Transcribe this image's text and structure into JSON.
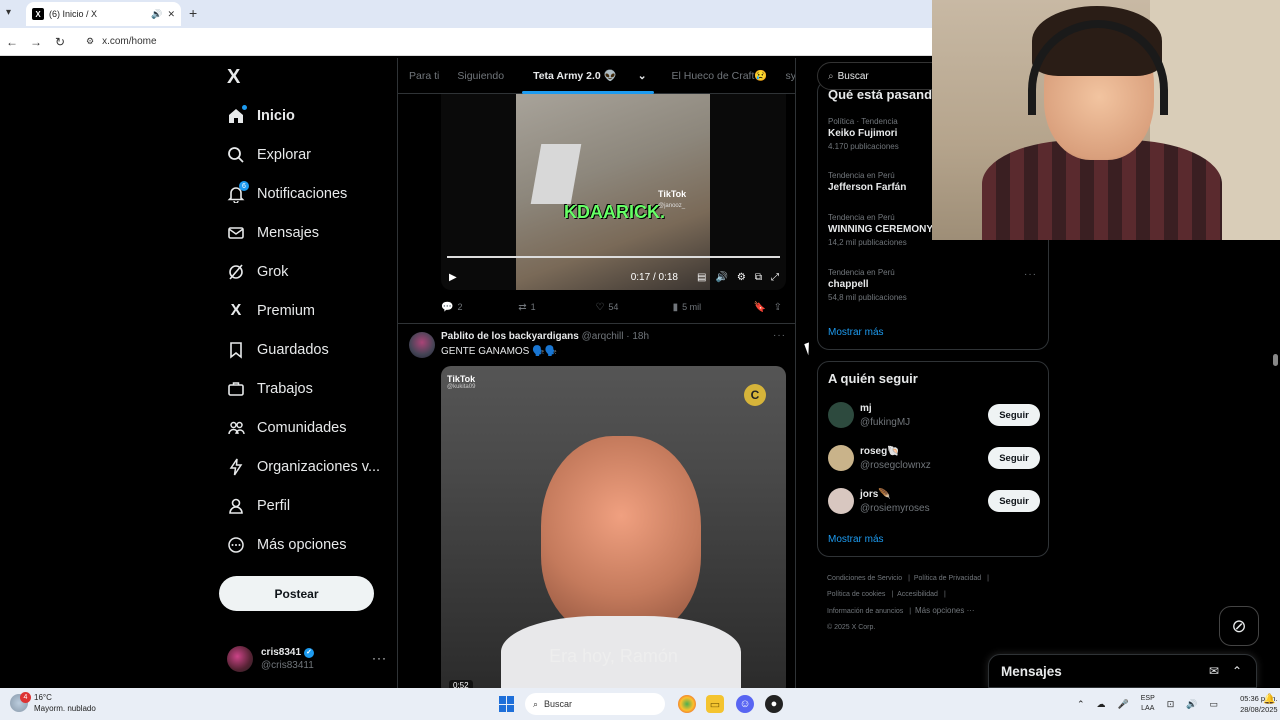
{
  "browser": {
    "tab_title": "(6) Inicio / X",
    "url": "x.com/home",
    "tab_audio_icon": "speaker-icon",
    "new_tab": "+"
  },
  "leftnav": {
    "logo": "X",
    "items": [
      {
        "label": "Inicio",
        "icon": "home-icon",
        "active": true
      },
      {
        "label": "Explorar",
        "icon": "search-icon"
      },
      {
        "label": "Notificaciones",
        "icon": "bell-icon",
        "badge": "6"
      },
      {
        "label": "Mensajes",
        "icon": "envelope-icon"
      },
      {
        "label": "Grok",
        "icon": "grok-icon"
      },
      {
        "label": "Premium",
        "icon": "x-icon"
      },
      {
        "label": "Guardados",
        "icon": "bookmark-icon"
      },
      {
        "label": "Trabajos",
        "icon": "briefcase-icon"
      },
      {
        "label": "Comunidades",
        "icon": "people-icon"
      },
      {
        "label": "Organizaciones v...",
        "icon": "lightning-icon"
      },
      {
        "label": "Perfil",
        "icon": "person-icon"
      },
      {
        "label": "Más opciones",
        "icon": "more-circle-icon"
      }
    ],
    "post_button": "Postear",
    "account": {
      "name": "cris8341",
      "handle": "@cris83411"
    }
  },
  "timeline": {
    "tabs": [
      "Para ti",
      "Siguiendo",
      "Teta Army 2.0 👽",
      "El Hueco de Craft😢",
      "sylville"
    ],
    "selected_tab": "Teta Army 2.0 👽",
    "tweet1": {
      "video": {
        "watermark": "TikTok",
        "watermark_handle": "@janooz_",
        "caption": "KDAARICK.",
        "time": "0:17 / 0:18"
      },
      "actions": {
        "replies": "2",
        "reposts": "1",
        "likes": "54",
        "views": "5 mil"
      }
    },
    "tweet2": {
      "name": "Pablito de los backyardigans",
      "handle": "@arqchill",
      "time": "· 18h",
      "text": "GENTE GANAMOS 🗣️🗣️",
      "video": {
        "watermark": "TikTok",
        "watermark_handle": "@kukita09",
        "corner_logo": "C",
        "caption": "Era hoy, Ramón",
        "duration": "0:52"
      }
    }
  },
  "sidebar": {
    "search_placeholder": "Buscar",
    "trends_title": "Qué está pasando",
    "trends": [
      {
        "context": "Política · Tendencia",
        "name": "Keiko Fujimori",
        "count": "4.170 publicaciones"
      },
      {
        "context": "Tendencia en Perú",
        "name": "Jefferson Farfán",
        "count": ""
      },
      {
        "context": "Tendencia en Perú",
        "name": "WINNING CEREMONY",
        "count": "14,2 mil publicaciones"
      },
      {
        "context": "Tendencia en Perú",
        "name": "chappell",
        "count": "54,8 mil publicaciones"
      }
    ],
    "trends_show_more": "Mostrar más",
    "follow_title": "A quién seguir",
    "follow": [
      {
        "name": "mj",
        "handle": "@fukingMJ",
        "button": "Seguir",
        "color": "#2d4a3e"
      },
      {
        "name": "roseg🐚",
        "handle": "@rosegclownxz",
        "button": "Seguir",
        "color": "#c9b38a"
      },
      {
        "name": "jors🪶",
        "handle": "@rosiemyroses",
        "button": "Seguir",
        "color": "#d8c7c0"
      }
    ],
    "follow_show_more": "Mostrar más",
    "footer": [
      "Condiciones de Servicio",
      "Política de Privacidad",
      "Política de cookies",
      "Accesibilidad",
      "Información de anuncios",
      "Más opciones ···",
      "© 2025 X Corp."
    ]
  },
  "messages_drawer": {
    "title": "Mensajes"
  },
  "taskbar": {
    "weather_temp": "16°C",
    "weather_desc": "Mayorm. nublado",
    "weather_badge": "4",
    "search": "Buscar",
    "lang1": "ESP",
    "lang2": "LAA",
    "time": "05:36 p. m.",
    "date": "28/08/2025"
  },
  "colors": {
    "accent": "#1d9bf0",
    "background": "#000000",
    "border": "#2f3336",
    "muted": "#71767b"
  }
}
